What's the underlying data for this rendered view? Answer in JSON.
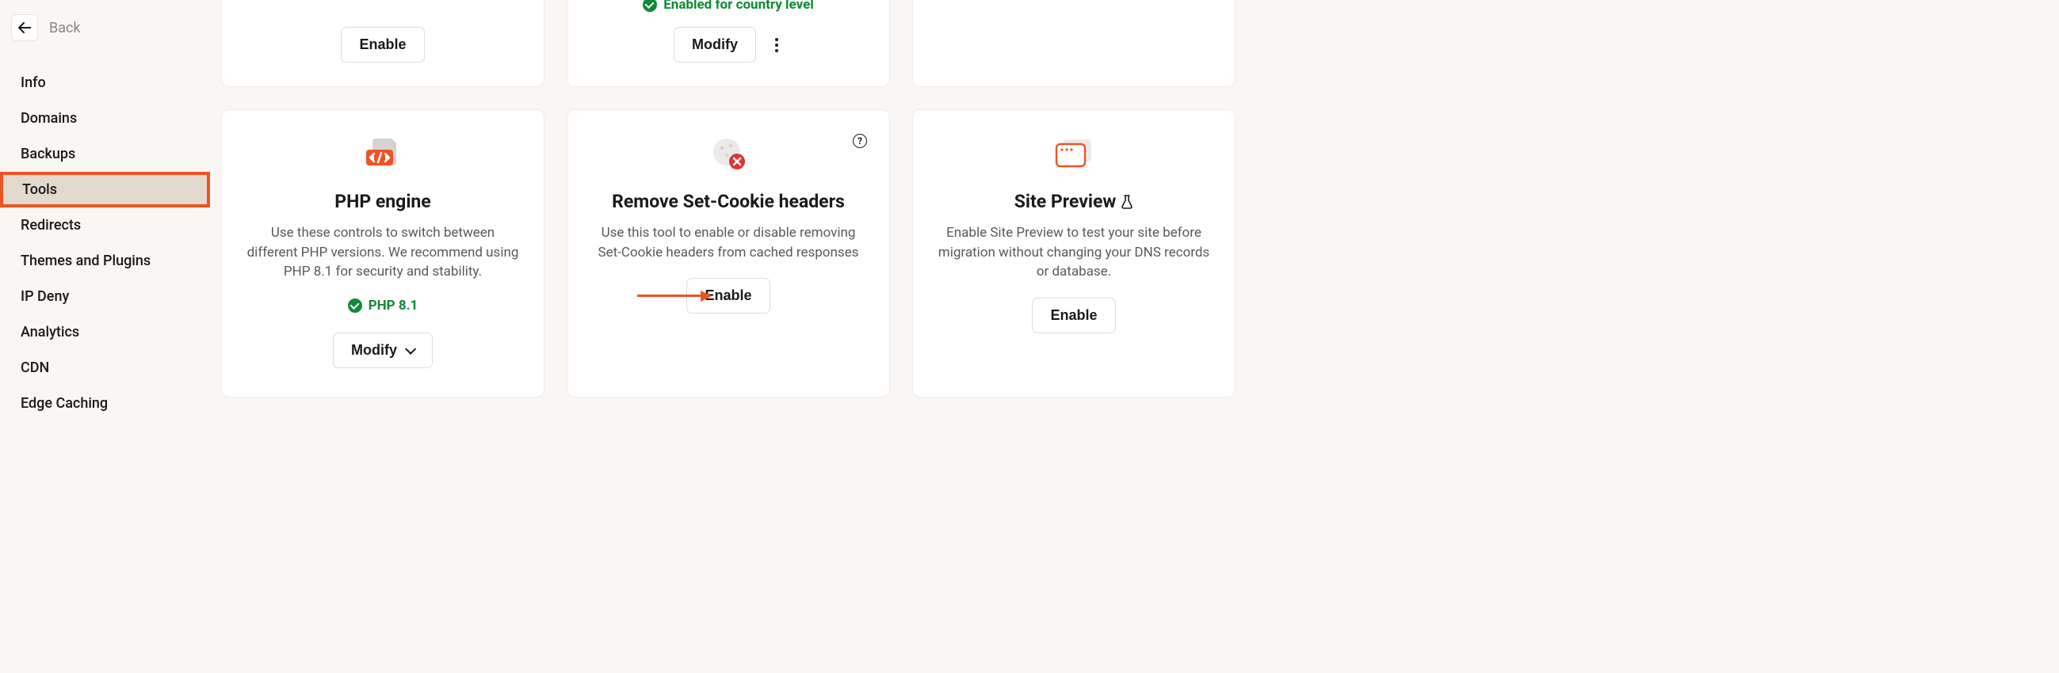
{
  "back": {
    "label": "Back"
  },
  "nav": {
    "items": [
      {
        "label": "Info"
      },
      {
        "label": "Domains"
      },
      {
        "label": "Backups"
      },
      {
        "label": "Tools",
        "active": true
      },
      {
        "label": "Redirects"
      },
      {
        "label": "Themes and Plugins"
      },
      {
        "label": "IP Deny"
      },
      {
        "label": "Analytics"
      },
      {
        "label": "CDN"
      },
      {
        "label": "Edge Caching"
      }
    ]
  },
  "partial_cards": {
    "left": {
      "button": "Enable"
    },
    "middle": {
      "status": "Enabled for country level",
      "button": "Modify"
    }
  },
  "cards": {
    "php": {
      "title": "PHP engine",
      "desc": "Use these controls to switch between different PHP versions. We recommend using PHP 8.1 for security and stability.",
      "version": "PHP 8.1",
      "button": "Modify"
    },
    "cookie": {
      "title": "Remove Set-Cookie headers",
      "desc": "Use this tool to enable or disable removing Set-Cookie headers from cached responses",
      "button": "Enable"
    },
    "preview": {
      "title": "Site Preview",
      "desc": "Enable Site Preview to test your site before migration without changing your DNS records or database.",
      "button": "Enable"
    }
  }
}
